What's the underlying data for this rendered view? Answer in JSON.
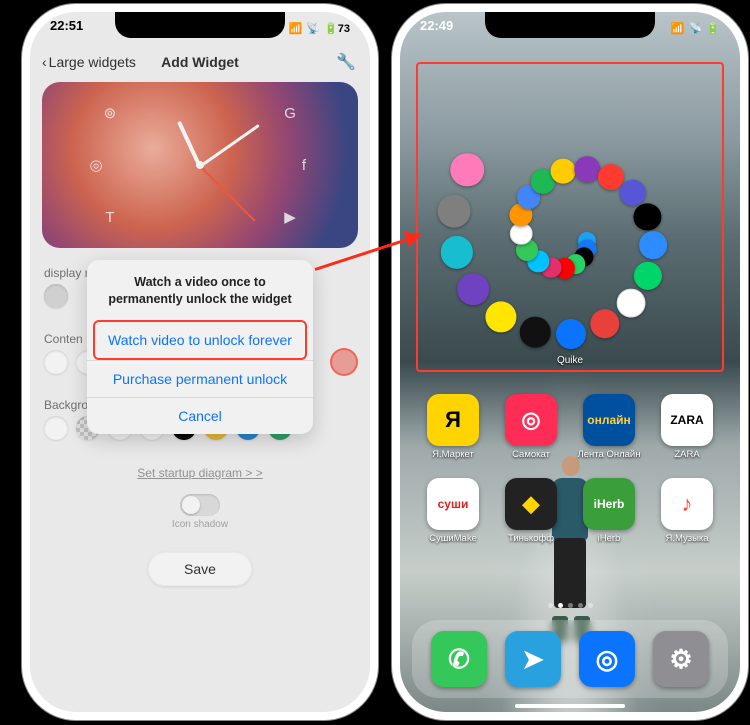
{
  "left": {
    "status": {
      "time": "22:51",
      "battery": "73"
    },
    "nav": {
      "back": "Large widgets",
      "title": "Add Widget"
    },
    "settings": {
      "label_display": "display n",
      "label_content": "Conten",
      "label_background": "Backgrou",
      "startup_link": "Set startup diagram > >",
      "toggle_label": "Icon shadow",
      "save": "Save"
    },
    "sheet": {
      "message": "Watch a video once to permanently unlock the widget",
      "watch": "Watch video to unlock forever",
      "purchase": "Purchase permanent unlock",
      "cancel": "Cancel"
    }
  },
  "right": {
    "status": {
      "time": "22:49"
    },
    "widget_label": "Quike",
    "apps_row1": [
      {
        "label": "Я.Маркет",
        "bg": "#ffd400",
        "fg": "#000",
        "glyph": "Я"
      },
      {
        "label": "Самокат",
        "bg": "#ff2d55",
        "fg": "#fff",
        "glyph": "◎"
      },
      {
        "label": "Лента Онлайн",
        "bg": "#0050a0",
        "fg": "#ffcf3a",
        "glyph": "онлайн"
      },
      {
        "label": "ZARA",
        "bg": "#ffffff",
        "fg": "#000",
        "glyph": "ZARA"
      }
    ],
    "apps_row2": [
      {
        "label": "СушиMake",
        "bg": "#ffffff",
        "fg": "#d22",
        "glyph": "суши"
      },
      {
        "label": "Тинькофф",
        "bg": "#222222",
        "fg": "#ffd400",
        "glyph": "◆"
      },
      {
        "label": "iHerb",
        "bg": "#3a9e3a",
        "fg": "#fff",
        "glyph": "iHerb"
      },
      {
        "label": "Я.Музыка",
        "bg": "#ffffff",
        "fg": "#ff4a2e",
        "glyph": "♪"
      }
    ],
    "dock": [
      {
        "name": "phone",
        "bg": "#34c759",
        "glyph": "✆"
      },
      {
        "name": "telegram",
        "bg": "#2aa1df",
        "glyph": "➤"
      },
      {
        "name": "safari",
        "bg": "#0a74ff",
        "glyph": "◎"
      },
      {
        "name": "settings",
        "bg": "#8e8e93",
        "glyph": "⚙"
      }
    ],
    "spiral_icons": [
      {
        "bg": "#1da1f2"
      },
      {
        "bg": "#1877f2"
      },
      {
        "bg": "#000000"
      },
      {
        "bg": "#25d366"
      },
      {
        "bg": "#ff0000"
      },
      {
        "bg": "#e1306c"
      },
      {
        "bg": "#00c4ff"
      },
      {
        "bg": "#34c759"
      },
      {
        "bg": "#ffffff"
      },
      {
        "bg": "#ff9500"
      },
      {
        "bg": "#4285f4"
      },
      {
        "bg": "#1db954"
      },
      {
        "bg": "#ffcc00"
      },
      {
        "bg": "#8a3ab9"
      },
      {
        "bg": "#ff3b30"
      },
      {
        "bg": "#5856d6"
      },
      {
        "bg": "#000000"
      },
      {
        "bg": "#2d8cff"
      },
      {
        "bg": "#00d56a"
      },
      {
        "bg": "#ffffff"
      },
      {
        "bg": "#e8413c"
      },
      {
        "bg": "#0a74ff"
      },
      {
        "bg": "#111111"
      },
      {
        "bg": "#ffe600"
      },
      {
        "bg": "#6f42c1"
      },
      {
        "bg": "#17becf"
      },
      {
        "bg": "#7f7f7f"
      },
      {
        "bg": "#ff7ab8"
      }
    ]
  }
}
